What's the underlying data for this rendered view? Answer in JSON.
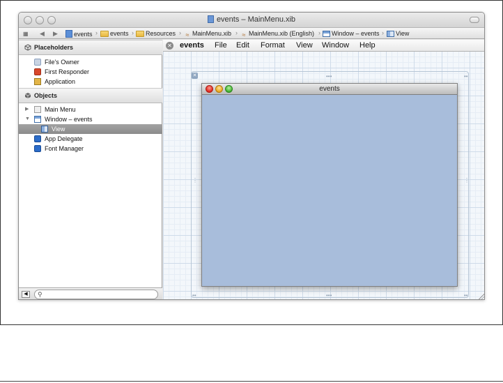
{
  "window": {
    "title": "events – MainMenu.xib"
  },
  "jumpbar": {
    "crumbs": [
      {
        "label": "events",
        "icon": "project-icon"
      },
      {
        "label": "events",
        "icon": "folder-icon"
      },
      {
        "label": "Resources",
        "icon": "folder-icon"
      },
      {
        "label": "MainMenu.xib",
        "icon": "xib-icon"
      },
      {
        "label": "MainMenu.xib (English)",
        "icon": "xib-icon"
      },
      {
        "label": "Window – events",
        "icon": "window-icon"
      },
      {
        "label": "View",
        "icon": "view-icon"
      }
    ]
  },
  "sidebar": {
    "placeholders_header": "Placeholders",
    "placeholders": [
      {
        "label": "File's Owner",
        "icon": "cube-outline-icon",
        "color": "#c9d4e3"
      },
      {
        "label": "First Responder",
        "icon": "first-responder-icon",
        "color": "#d9482b"
      },
      {
        "label": "Application",
        "icon": "app-icon",
        "color": "#e3b548"
      }
    ],
    "objects_header": "Objects",
    "objects": [
      {
        "label": "Main Menu",
        "icon": "menu-icon",
        "color": "#e7e7e7"
      },
      {
        "label": "Window – events",
        "icon": "window-icon",
        "color": "#7aa3d8"
      },
      {
        "label": "View",
        "icon": "view-icon",
        "color": "#8db0df"
      },
      {
        "label": "App Delegate",
        "icon": "blue-cube-icon",
        "color": "#2b6cc9"
      },
      {
        "label": "Font Manager",
        "icon": "blue-cube-icon",
        "color": "#2b6cc9"
      }
    ]
  },
  "menubar": {
    "items": [
      "events",
      "File",
      "Edit",
      "Format",
      "View",
      "Window",
      "Help"
    ]
  },
  "canvas": {
    "inner_window_title": "events"
  },
  "colors": {
    "view_background": "#a8bddb",
    "selected_row": "#8b8b8b"
  }
}
